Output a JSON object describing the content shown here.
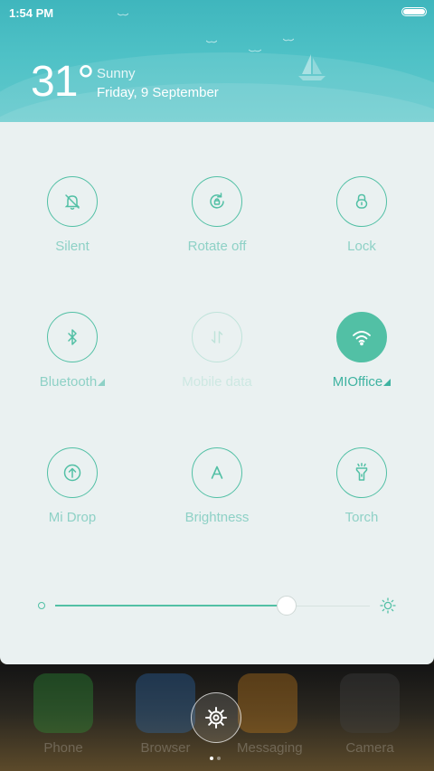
{
  "status_bar": {
    "time": "1:54 PM",
    "battery_level": 1.0
  },
  "weather": {
    "temperature": "31°",
    "condition": "Sunny",
    "date": "Friday, 9 September"
  },
  "toggles": [
    {
      "label": "Silent",
      "icon": "bell-off-icon",
      "state": "off"
    },
    {
      "label": "Rotate off",
      "icon": "rotate-lock-icon",
      "state": "off"
    },
    {
      "label": "Lock",
      "icon": "lock-icon",
      "state": "off"
    },
    {
      "label": "Bluetooth",
      "icon": "bluetooth-icon",
      "state": "off"
    },
    {
      "label": "Mobile data",
      "icon": "mobile-data-icon",
      "state": "disabled"
    },
    {
      "label": "MIOffice",
      "icon": "wifi-icon",
      "state": "on"
    },
    {
      "label": "Mi Drop",
      "icon": "mi-drop-icon",
      "state": "off"
    },
    {
      "label": "Brightness",
      "icon": "brightness-auto-icon",
      "state": "off"
    },
    {
      "label": "Torch",
      "icon": "torch-icon",
      "state": "off"
    }
  ],
  "brightness": {
    "level": 0.736
  },
  "dock": {
    "apps": [
      {
        "label": "Phone",
        "color": "#2e9e3a"
      },
      {
        "label": "Browser",
        "color": "#2f6fb8"
      },
      {
        "label": "Messaging",
        "color": "#d0851e"
      },
      {
        "label": "Camera",
        "color": "#444444"
      }
    ]
  },
  "colors": {
    "accent": "#52c0a5",
    "panel": "#eaf1f1",
    "header": "#4ec1c6"
  }
}
